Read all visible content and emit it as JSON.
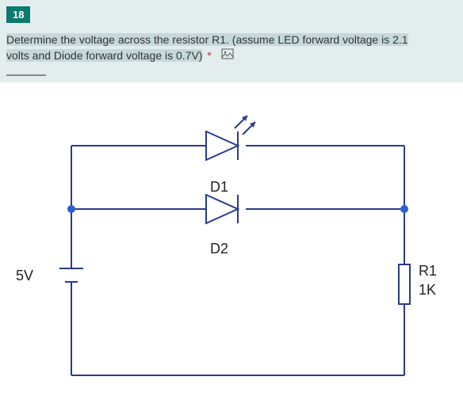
{
  "question": {
    "number": "18",
    "text_part1": "Determine the voltage across the resistor R1. (assume LED forward voltage is 2.1",
    "text_part2": "volts and Diode forward voltage is 0.7V)",
    "required_mark": "*"
  },
  "circuit": {
    "source_label": "5V",
    "d1_label": "D1",
    "d2_label": "D2",
    "r1_label": "R1",
    "r1_value": "1K"
  }
}
